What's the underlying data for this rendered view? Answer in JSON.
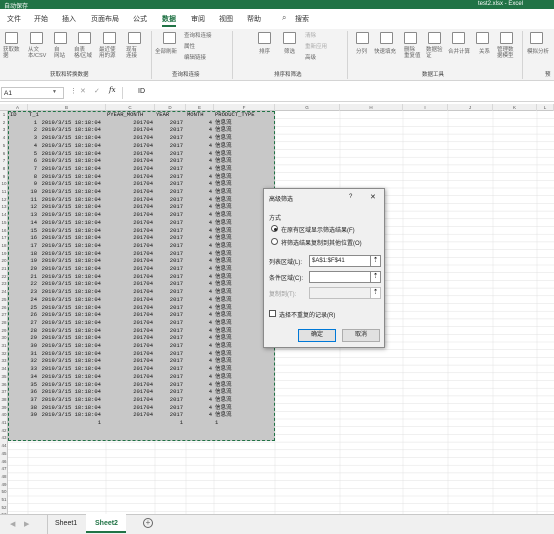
{
  "window": {
    "title": "test2.xlsx - Excel",
    "autosave": "自动保存"
  },
  "tabs": [
    "文件",
    "开始",
    "插入",
    "页面布局",
    "公式",
    "数据",
    "审阅",
    "视图",
    "帮助"
  ],
  "active_tab": "数据",
  "search": "搜索",
  "ribbon": {
    "buttons": [
      {
        "label": "获取数",
        "label2": "据"
      },
      {
        "label": "从文",
        "label2": "本/CSV"
      },
      {
        "label": "自",
        "label2": "网站"
      },
      {
        "label": "自表",
        "label2": "格/区域"
      },
      {
        "label": "最近使",
        "label2": "用的源"
      },
      {
        "label": "现有",
        "label2": "连接"
      },
      {
        "label": "全部刷新"
      },
      {
        "label": "排序"
      },
      {
        "label": "筛选"
      },
      {
        "label": "分列"
      },
      {
        "label": "快速填充"
      },
      {
        "label": "删除",
        "label2": "重复值"
      },
      {
        "label": "数据验",
        "label2": "证"
      },
      {
        "label": "合并计算"
      },
      {
        "label": "关系"
      },
      {
        "label": "管理数",
        "label2": "据模型"
      },
      {
        "label": "模拟分析"
      }
    ],
    "small_buttons": [
      "查询和连接",
      "属性",
      "编辑链接",
      "清除",
      "重新应用",
      "高级"
    ],
    "groups": [
      "获取和转换数据",
      "查询和连接",
      "排序和筛选",
      "数据工具",
      "预"
    ]
  },
  "formula_bar": {
    "name_box": "A1",
    "fx": "fx",
    "value": "ID"
  },
  "columns": [
    "A",
    "B",
    "C",
    "D",
    "E",
    "F",
    "G",
    "H",
    "I",
    "J",
    "K",
    "L"
  ],
  "headers": [
    "ID",
    "T_1",
    "PYEAR_MONTH",
    "YEAR",
    "MONTH",
    "PRODUCT_TYPE"
  ],
  "row_numbers": [
    "1",
    "2",
    "3",
    "4",
    "5",
    "6",
    "7",
    "8",
    "9",
    "10",
    "11",
    "12",
    "13",
    "14",
    "15",
    "16",
    "17",
    "18",
    "19",
    "20",
    "21",
    "22",
    "23",
    "24",
    "25",
    "26",
    "27",
    "28",
    "29",
    "30",
    "31",
    "32",
    "33",
    "34",
    "35",
    "36",
    "37",
    "38",
    "39",
    "40",
    "41",
    "42",
    "43",
    "44",
    "45",
    "46",
    "47",
    "48",
    "49",
    "50",
    "51",
    "52",
    "53"
  ],
  "rows": [
    {
      "id": "1",
      "t1": "2019/3/15 18:18:04",
      "pym": "201704",
      "year": "2017",
      "month": "4",
      "type": "信息流"
    },
    {
      "id": "2",
      "t1": "2019/3/15 18:18:04",
      "pym": "201704",
      "year": "2017",
      "month": "4",
      "type": "信息流"
    },
    {
      "id": "3",
      "t1": "2019/3/15 18:18:04",
      "pym": "201704",
      "year": "2017",
      "month": "4",
      "type": "信息流"
    },
    {
      "id": "4",
      "t1": "2019/3/15 18:18:04",
      "pym": "201704",
      "year": "2017",
      "month": "4",
      "type": "信息流"
    },
    {
      "id": "5",
      "t1": "2019/3/15 18:18:04",
      "pym": "201704",
      "year": "2017",
      "month": "4",
      "type": "信息流"
    },
    {
      "id": "6",
      "t1": "2019/3/15 18:18:04",
      "pym": "201704",
      "year": "2017",
      "month": "4",
      "type": "信息流"
    },
    {
      "id": "7",
      "t1": "2019/3/15 18:18:04",
      "pym": "201704",
      "year": "2017",
      "month": "4",
      "type": "信息流"
    },
    {
      "id": "8",
      "t1": "2019/3/15 18:18:04",
      "pym": "201704",
      "year": "2017",
      "month": "4",
      "type": "信息流"
    },
    {
      "id": "9",
      "t1": "2019/3/15 18:18:04",
      "pym": "201704",
      "year": "2017",
      "month": "4",
      "type": "信息流"
    },
    {
      "id": "10",
      "t1": "2019/3/15 18:18:04",
      "pym": "201704",
      "year": "2017",
      "month": "4",
      "type": "信息流"
    },
    {
      "id": "11",
      "t1": "2019/3/15 18:18:04",
      "pym": "201704",
      "year": "2017",
      "month": "4",
      "type": "信息流"
    },
    {
      "id": "12",
      "t1": "2019/3/15 18:18:04",
      "pym": "201704",
      "year": "2017",
      "month": "4",
      "type": "信息流"
    },
    {
      "id": "13",
      "t1": "2019/3/15 18:18:04",
      "pym": "201704",
      "year": "2017",
      "month": "4",
      "type": "信息流"
    },
    {
      "id": "14",
      "t1": "2019/3/15 18:18:04",
      "pym": "201704",
      "year": "2017",
      "month": "4",
      "type": "信息流"
    },
    {
      "id": "15",
      "t1": "2019/3/15 18:18:04",
      "pym": "201704",
      "year": "2017",
      "month": "4",
      "type": "信息流"
    },
    {
      "id": "16",
      "t1": "2019/3/15 18:18:04",
      "pym": "201704",
      "year": "2017",
      "month": "4",
      "type": "信息流"
    },
    {
      "id": "17",
      "t1": "2019/3/15 18:18:04",
      "pym": "201704",
      "year": "2017",
      "month": "4",
      "type": "信息流"
    },
    {
      "id": "18",
      "t1": "2019/3/15 18:18:04",
      "pym": "201704",
      "year": "2017",
      "month": "4",
      "type": "信息流"
    },
    {
      "id": "19",
      "t1": "2019/3/15 18:18:04",
      "pym": "201704",
      "year": "2017",
      "month": "4",
      "type": "信息流"
    },
    {
      "id": "20",
      "t1": "2019/3/15 18:18:04",
      "pym": "201704",
      "year": "2017",
      "month": "4",
      "type": "信息流"
    },
    {
      "id": "21",
      "t1": "2019/3/15 18:18:04",
      "pym": "201704",
      "year": "2017",
      "month": "4",
      "type": "信息流"
    },
    {
      "id": "22",
      "t1": "2019/3/15 18:18:04",
      "pym": "201704",
      "year": "2017",
      "month": "4",
      "type": "信息流"
    },
    {
      "id": "23",
      "t1": "2019/3/15 18:18:04",
      "pym": "201704",
      "year": "2017",
      "month": "4",
      "type": "信息流"
    },
    {
      "id": "24",
      "t1": "2019/3/15 18:18:04",
      "pym": "201704",
      "year": "2017",
      "month": "4",
      "type": "信息流"
    },
    {
      "id": "25",
      "t1": "2019/3/15 18:18:04",
      "pym": "201704",
      "year": "2017",
      "month": "4",
      "type": "信息流"
    },
    {
      "id": "26",
      "t1": "2019/3/15 18:18:04",
      "pym": "201704",
      "year": "2017",
      "month": "4",
      "type": "信息流"
    },
    {
      "id": "27",
      "t1": "2019/3/15 18:18:04",
      "pym": "201704",
      "year": "2017",
      "month": "4",
      "type": "信息流"
    },
    {
      "id": "28",
      "t1": "2019/3/15 18:18:04",
      "pym": "201704",
      "year": "2017",
      "month": "4",
      "type": "信息流"
    },
    {
      "id": "29",
      "t1": "2019/3/15 18:18:04",
      "pym": "201704",
      "year": "2017",
      "month": "4",
      "type": "信息流"
    },
    {
      "id": "30",
      "t1": "2019/3/15 18:18:04",
      "pym": "201704",
      "year": "2017",
      "month": "4",
      "type": "信息流"
    },
    {
      "id": "31",
      "t1": "2019/3/15 18:18:04",
      "pym": "201704",
      "year": "2017",
      "month": "4",
      "type": "信息流"
    },
    {
      "id": "32",
      "t1": "2019/3/15 18:18:04",
      "pym": "201704",
      "year": "2017",
      "month": "4",
      "type": "信息流"
    },
    {
      "id": "33",
      "t1": "2019/3/15 18:18:04",
      "pym": "201704",
      "year": "2017",
      "month": "4",
      "type": "信息流"
    },
    {
      "id": "34",
      "t1": "2019/3/15 18:18:04",
      "pym": "201704",
      "year": "2017",
      "month": "4",
      "type": "信息流"
    },
    {
      "id": "35",
      "t1": "2019/3/15 18:18:04",
      "pym": "201704",
      "year": "2017",
      "month": "4",
      "type": "信息流"
    },
    {
      "id": "36",
      "t1": "2019/3/15 18:18:04",
      "pym": "201704",
      "year": "2017",
      "month": "4",
      "type": "信息流"
    },
    {
      "id": "37",
      "t1": "2019/3/15 18:18:04",
      "pym": "201704",
      "year": "2017",
      "month": "4",
      "type": "信息流"
    },
    {
      "id": "38",
      "t1": "2019/3/15 18:18:04",
      "pym": "201704",
      "year": "2017",
      "month": "4",
      "type": "信息流"
    },
    {
      "id": "39",
      "t1": "2019/3/15 18:18:04",
      "pym": "201704",
      "year": "2017",
      "month": "4",
      "type": "信息流"
    },
    {
      "id": "",
      "t1": "1",
      "pym": "",
      "year": "1",
      "month": "",
      "type": "1"
    }
  ],
  "sheets": [
    "Sheet1",
    "Sheet2"
  ],
  "active_sheet": "Sheet2",
  "dialog": {
    "title": "高级筛选",
    "help": "?",
    "close": "✕",
    "mode_label": "方式",
    "option1": "在原有区域显示筛选结果(F)",
    "option2": "将筛选结果复制到其他位置(O)",
    "list_range_label": "列表区域(L):",
    "list_range_value": "$A$1:$F$41",
    "criteria_label": "条件区域(C):",
    "criteria_value": "",
    "copy_to_label": "复制到(T):",
    "copy_to_value": "",
    "unique_label": "选择不重复的记录(R)",
    "ok": "确定",
    "cancel": "取消"
  }
}
